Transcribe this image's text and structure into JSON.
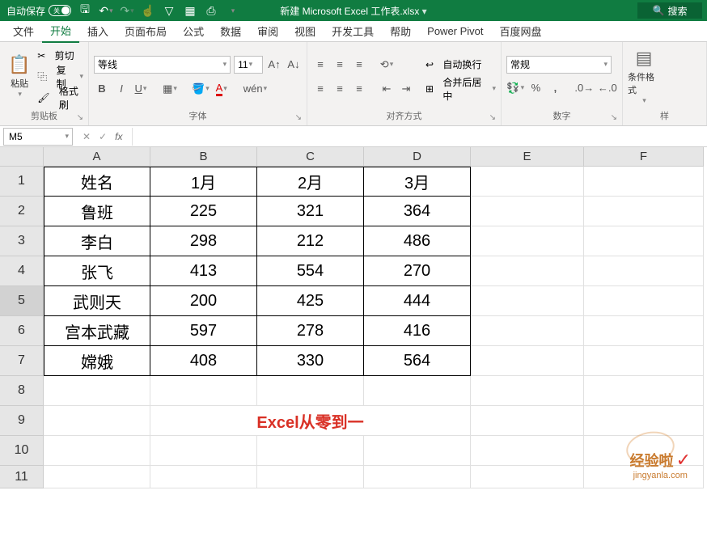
{
  "titlebar": {
    "autosave_label": "自动保存",
    "autosave_state": "关",
    "doc_title": "新建 Microsoft Excel 工作表.xlsx",
    "search_placeholder": "搜索"
  },
  "tabs": {
    "items": [
      {
        "label": "文件"
      },
      {
        "label": "开始"
      },
      {
        "label": "插入"
      },
      {
        "label": "页面布局"
      },
      {
        "label": "公式"
      },
      {
        "label": "数据"
      },
      {
        "label": "审阅"
      },
      {
        "label": "视图"
      },
      {
        "label": "开发工具"
      },
      {
        "label": "帮助"
      },
      {
        "label": "Power Pivot"
      },
      {
        "label": "百度网盘"
      }
    ],
    "active_index": 1
  },
  "ribbon": {
    "clipboard": {
      "paste": "粘贴",
      "cut": "剪切",
      "copy": "复制",
      "format_painter": "格式刷",
      "label": "剪贴板"
    },
    "font": {
      "name": "等线",
      "size": "11",
      "label": "字体"
    },
    "alignment": {
      "wrap": "自动换行",
      "merge": "合并后居中",
      "label": "对齐方式"
    },
    "number": {
      "format": "常规",
      "label": "数字"
    },
    "styles": {
      "conditional": "条件格式",
      "label": "样"
    }
  },
  "namebox": {
    "value": "M5"
  },
  "columns": [
    "A",
    "B",
    "C",
    "D",
    "E",
    "F"
  ],
  "rows": [
    "1",
    "2",
    "3",
    "4",
    "5",
    "6",
    "7",
    "8",
    "9",
    "10",
    "11"
  ],
  "table": {
    "headers": [
      "姓名",
      "1月",
      "2月",
      "3月"
    ],
    "data": [
      {
        "name": "鲁班",
        "m1": "225",
        "m2": "321",
        "m3": "364"
      },
      {
        "name": "李白",
        "m1": "298",
        "m2": "212",
        "m3": "486"
      },
      {
        "name": "张飞",
        "m1": "413",
        "m2": "554",
        "m3": "270"
      },
      {
        "name": "武则天",
        "m1": "200",
        "m2": "425",
        "m3": "444"
      },
      {
        "name": "宫本武藏",
        "m1": "597",
        "m2": "278",
        "m3": "416"
      },
      {
        "name": "嫦娥",
        "m1": "408",
        "m2": "330",
        "m3": "564"
      }
    ]
  },
  "note": "Excel从零到一",
  "watermark": {
    "ch": "经验啦",
    "en": "jingyanla.com"
  }
}
